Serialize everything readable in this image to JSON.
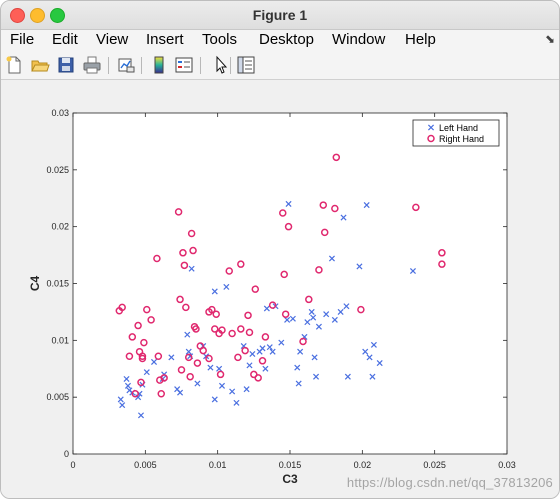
{
  "window": {
    "title": "Figure 1"
  },
  "menu": {
    "items": [
      "File",
      "Edit",
      "View",
      "Insert",
      "Tools",
      "Desktop",
      "Window",
      "Help"
    ]
  },
  "toolbar": {
    "icons": [
      "new-figure-icon",
      "open-file-icon",
      "save-icon",
      "print-icon",
      "link-plot-icon",
      "insert-colorbar-icon",
      "insert-legend-icon",
      "edit-plot-icon",
      "property-editor-icon"
    ]
  },
  "watermark": "https://blog.csdn.net/qq_37813206",
  "chart_data": {
    "type": "scatter",
    "title": "",
    "xlabel": "C3",
    "ylabel": "C4",
    "xlim": [
      0,
      0.03
    ],
    "ylim": [
      0,
      0.03
    ],
    "xticks": [
      "0",
      "0.005",
      "0.01",
      "0.015",
      "0.02",
      "0.025",
      "0.03"
    ],
    "yticks": [
      "0",
      "0.005",
      "0.01",
      "0.015",
      "0.02",
      "0.025",
      "0.03"
    ],
    "grid": false,
    "legend_position": "top-right",
    "series": [
      {
        "name": "Left Hand",
        "marker": "x",
        "color": "#4a6fe0",
        "points": [
          [
            0.0033,
            0.0048
          ],
          [
            0.0034,
            0.0043
          ],
          [
            0.0037,
            0.0066
          ],
          [
            0.0038,
            0.006
          ],
          [
            0.0039,
            0.0056
          ],
          [
            0.0041,
            0.0054
          ],
          [
            0.0045,
            0.005
          ],
          [
            0.0046,
            0.0053
          ],
          [
            0.0047,
            0.0034
          ],
          [
            0.0048,
            0.0061
          ],
          [
            0.0051,
            0.0072
          ],
          [
            0.0056,
            0.0081
          ],
          [
            0.0062,
            0.0066
          ],
          [
            0.0063,
            0.007
          ],
          [
            0.0068,
            0.0085
          ],
          [
            0.0072,
            0.0057
          ],
          [
            0.0074,
            0.0054
          ],
          [
            0.0079,
            0.0105
          ],
          [
            0.008,
            0.009
          ],
          [
            0.0081,
            0.0086
          ],
          [
            0.0082,
            0.0163
          ],
          [
            0.0086,
            0.0062
          ],
          [
            0.009,
            0.0095
          ],
          [
            0.0092,
            0.0086
          ],
          [
            0.0095,
            0.0076
          ],
          [
            0.0098,
            0.0143
          ],
          [
            0.0098,
            0.0048
          ],
          [
            0.0101,
            0.0075
          ],
          [
            0.0103,
            0.006
          ],
          [
            0.0106,
            0.0147
          ],
          [
            0.011,
            0.0055
          ],
          [
            0.0113,
            0.0045
          ],
          [
            0.0118,
            0.0095
          ],
          [
            0.012,
            0.0057
          ],
          [
            0.0122,
            0.0078
          ],
          [
            0.0124,
            0.0088
          ],
          [
            0.0129,
            0.009
          ],
          [
            0.0131,
            0.0093
          ],
          [
            0.0133,
            0.0075
          ],
          [
            0.0134,
            0.0128
          ],
          [
            0.0136,
            0.0094
          ],
          [
            0.0138,
            0.009
          ],
          [
            0.014,
            0.013
          ],
          [
            0.0144,
            0.0098
          ],
          [
            0.0148,
            0.0118
          ],
          [
            0.0149,
            0.022
          ],
          [
            0.0152,
            0.0119
          ],
          [
            0.0155,
            0.0076
          ],
          [
            0.0156,
            0.0062
          ],
          [
            0.0157,
            0.009
          ],
          [
            0.016,
            0.0103
          ],
          [
            0.0162,
            0.0116
          ],
          [
            0.0165,
            0.0125
          ],
          [
            0.0166,
            0.012
          ],
          [
            0.0167,
            0.0085
          ],
          [
            0.0168,
            0.0068
          ],
          [
            0.017,
            0.0112
          ],
          [
            0.0175,
            0.0123
          ],
          [
            0.0179,
            0.0172
          ],
          [
            0.0181,
            0.0118
          ],
          [
            0.0185,
            0.0125
          ],
          [
            0.0187,
            0.0208
          ],
          [
            0.0189,
            0.013
          ],
          [
            0.019,
            0.0068
          ],
          [
            0.0198,
            0.0165
          ],
          [
            0.0202,
            0.009
          ],
          [
            0.0203,
            0.0219
          ],
          [
            0.0205,
            0.0085
          ],
          [
            0.0207,
            0.0068
          ],
          [
            0.0208,
            0.0096
          ],
          [
            0.0212,
            0.008
          ],
          [
            0.0235,
            0.0161
          ]
        ]
      },
      {
        "name": "Right Hand",
        "marker": "o",
        "color": "#e0286e",
        "points": [
          [
            0.0032,
            0.0126
          ],
          [
            0.0034,
            0.0129
          ],
          [
            0.0039,
            0.0086
          ],
          [
            0.0041,
            0.0103
          ],
          [
            0.0043,
            0.0053
          ],
          [
            0.0045,
            0.0113
          ],
          [
            0.0046,
            0.009
          ],
          [
            0.0047,
            0.0063
          ],
          [
            0.0048,
            0.0086
          ],
          [
            0.0048,
            0.0084
          ],
          [
            0.0049,
            0.0098
          ],
          [
            0.0051,
            0.0127
          ],
          [
            0.0054,
            0.0118
          ],
          [
            0.0058,
            0.0172
          ],
          [
            0.0059,
            0.0086
          ],
          [
            0.006,
            0.0065
          ],
          [
            0.0061,
            0.0053
          ],
          [
            0.0063,
            0.0067
          ],
          [
            0.0073,
            0.0213
          ],
          [
            0.0074,
            0.0136
          ],
          [
            0.0075,
            0.0074
          ],
          [
            0.0076,
            0.0177
          ],
          [
            0.0077,
            0.0166
          ],
          [
            0.0078,
            0.0129
          ],
          [
            0.008,
            0.0085
          ],
          [
            0.0081,
            0.0068
          ],
          [
            0.0082,
            0.0194
          ],
          [
            0.0083,
            0.0179
          ],
          [
            0.0084,
            0.0112
          ],
          [
            0.0085,
            0.011
          ],
          [
            0.0086,
            0.008
          ],
          [
            0.0088,
            0.0095
          ],
          [
            0.009,
            0.0091
          ],
          [
            0.0094,
            0.0125
          ],
          [
            0.0094,
            0.0084
          ],
          [
            0.0096,
            0.0127
          ],
          [
            0.0098,
            0.011
          ],
          [
            0.0099,
            0.0123
          ],
          [
            0.0101,
            0.0106
          ],
          [
            0.0102,
            0.007
          ],
          [
            0.0103,
            0.0109
          ],
          [
            0.0108,
            0.0161
          ],
          [
            0.011,
            0.0106
          ],
          [
            0.0114,
            0.0085
          ],
          [
            0.0116,
            0.0167
          ],
          [
            0.0116,
            0.011
          ],
          [
            0.0119,
            0.0091
          ],
          [
            0.0121,
            0.0122
          ],
          [
            0.0122,
            0.0107
          ],
          [
            0.0125,
            0.007
          ],
          [
            0.0126,
            0.0145
          ],
          [
            0.0128,
            0.0067
          ],
          [
            0.0131,
            0.0082
          ],
          [
            0.0133,
            0.0103
          ],
          [
            0.0138,
            0.0131
          ],
          [
            0.0145,
            0.0212
          ],
          [
            0.0146,
            0.0158
          ],
          [
            0.0147,
            0.0123
          ],
          [
            0.0149,
            0.02
          ],
          [
            0.0159,
            0.0099
          ],
          [
            0.0163,
            0.0136
          ],
          [
            0.017,
            0.0162
          ],
          [
            0.0173,
            0.0219
          ],
          [
            0.0174,
            0.0195
          ],
          [
            0.0181,
            0.0216
          ],
          [
            0.0182,
            0.0261
          ],
          [
            0.0199,
            0.0127
          ],
          [
            0.0237,
            0.0217
          ],
          [
            0.0255,
            0.0177
          ],
          [
            0.0255,
            0.0167
          ]
        ]
      }
    ]
  }
}
